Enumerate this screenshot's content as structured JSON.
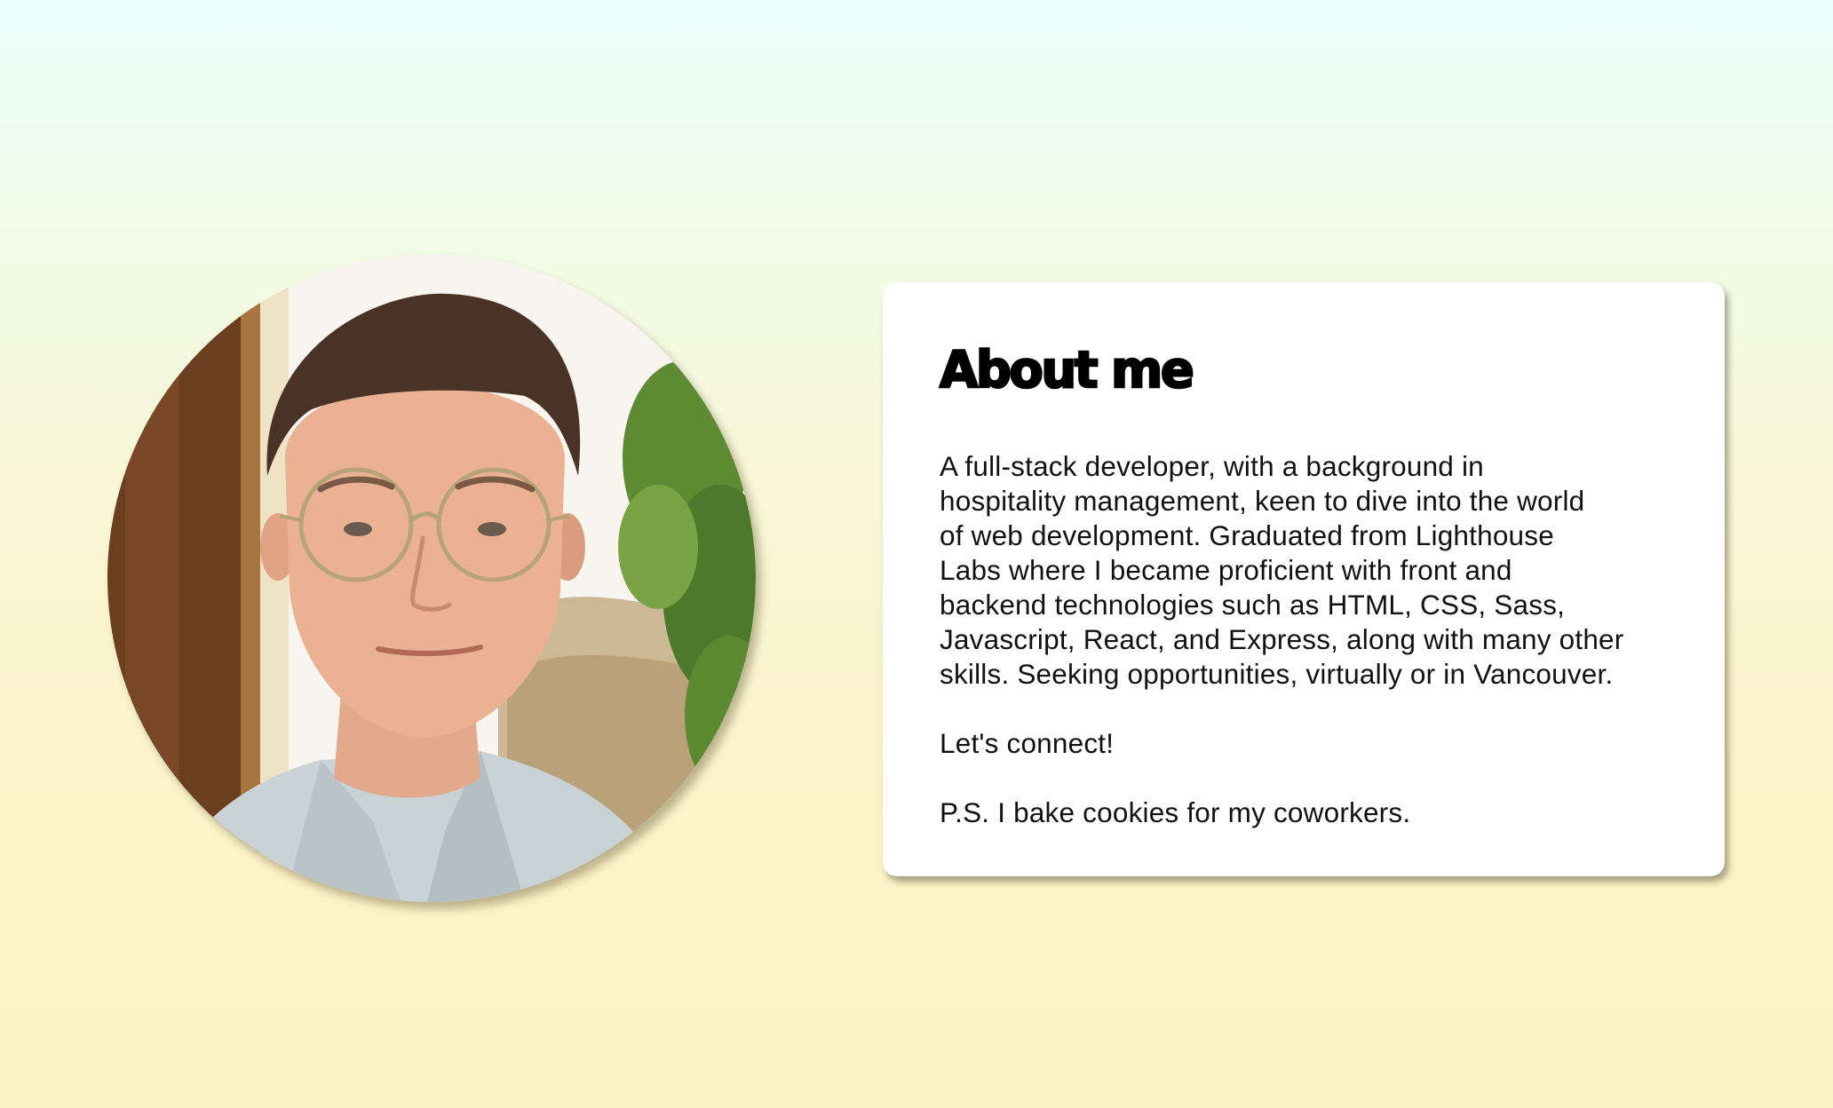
{
  "about": {
    "heading": "About me",
    "bio_lines": [
      "A full-stack developer, with a background in",
      "hospitality management, keen to dive into the world",
      "of web development. Graduated from Lighthouse",
      "Labs where I became proficient with front and",
      "backend technologies such as HTML, CSS, Sass,",
      "Javascript, React, and Express, along with many other",
      "skills. Seeking opportunities, virtually or in Vancouver."
    ],
    "cta": "Let's connect!",
    "postscript": "P.S. I bake cookies for my coworkers."
  },
  "colors": {
    "background_top": "#eafefc",
    "background_bottom": "#fdf2c5",
    "card": "#ffffff",
    "text": "#111111"
  }
}
